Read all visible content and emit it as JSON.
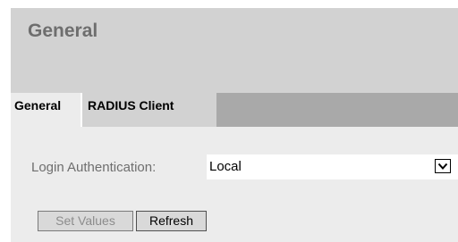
{
  "header": {
    "title": "General"
  },
  "tabs": [
    {
      "label": "General",
      "active": true
    },
    {
      "label": "RADIUS Client",
      "active": false
    }
  ],
  "form": {
    "login_auth_label": "Login Authentication:",
    "login_auth_value": "Local"
  },
  "buttons": {
    "set_values_label": "Set Values",
    "set_values_enabled": false,
    "refresh_label": "Refresh"
  },
  "colors": {
    "header_bg": "#d2d2d2",
    "tabbar_bg": "#a9a9a9",
    "content_bg": "#ececec",
    "title_text": "#6e6e6e"
  },
  "icons": {
    "dropdown": "chevron-down-icon"
  }
}
